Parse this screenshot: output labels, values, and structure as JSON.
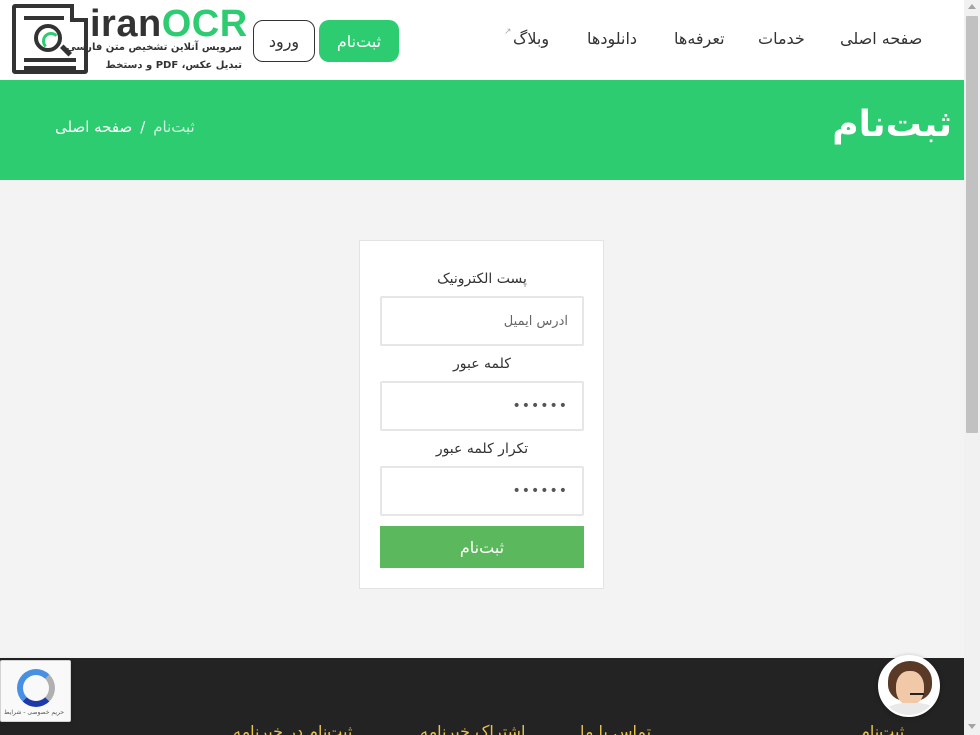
{
  "logo": {
    "brand_part1": "iran",
    "brand_part2": "OCR",
    "tagline_line1": "سرویس آنلاین تشخیص متن فارسی",
    "tagline_line2": "تبدیل عکس، PDF و دستخط",
    "icon": "document-magnifier-icon"
  },
  "header": {
    "login_label": "ورود",
    "signup_label": "ثبت‌نام",
    "nav": {
      "home": "صفحه اصلی",
      "services": "خدمات",
      "prices": "تعرفه‌ها",
      "downloads": "دانلودها",
      "blog": "وبلاگ",
      "blog_icon": "external-link-icon"
    }
  },
  "banner": {
    "title": "ثبت‌نام",
    "breadcrumb": {
      "home": "صفحه اصلی",
      "separator": "/",
      "current": "ثبت‌نام"
    }
  },
  "form": {
    "email_label": "پست الکترونیک",
    "email_placeholder": "آدرس ایمیل",
    "password_label": "کلمه عبور",
    "password_value": "••••••",
    "password_repeat_label": "تکرار کلمه عبور",
    "password_repeat_value": "••••••",
    "submit_label": "ثبت‌نام"
  },
  "footer": {
    "peek_texts": [
      "ثبت‌نام در خبرنامه",
      "اشتراک خبرنامه",
      "تماس با ما",
      "ثبت‌نام"
    ]
  },
  "recaptcha": {
    "text": "حریم خصوصی - شرایط"
  },
  "colors": {
    "brand_green": "#2ecc71",
    "submit_green": "#5cb85c",
    "footer_dark": "#232323"
  }
}
